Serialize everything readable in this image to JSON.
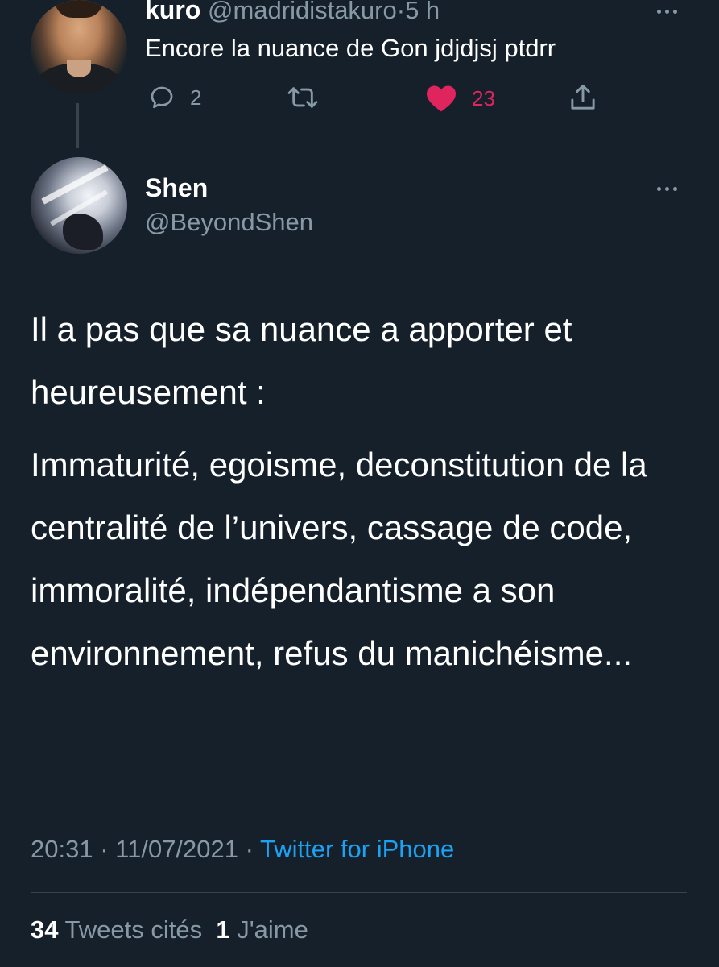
{
  "parent_tweet": {
    "author_name": "kuro",
    "handle": "@madridistakuro",
    "separator": "·",
    "time": "5 h",
    "text": "Encore la nuance de Gon jdjdjsj ptdrr",
    "reply_count": "2",
    "like_count": "23",
    "icons": [
      "reply-icon",
      "retweet-icon",
      "heart-icon",
      "share-icon",
      "more-icon"
    ],
    "liked_color": "#e0245e"
  },
  "main_tweet": {
    "author_name": "Shen",
    "handle": "@BeyondShen",
    "paragraphs": [
      "Il a pas que sa nuance a apporter et heureusement :",
      "Immaturité, egoisme, deconstitution de la centralité de l’univers, cassage de code, immoralité, indépendantisme a son environnement, refus du manichéisme..."
    ],
    "time": "20:31",
    "date": "11/07/2021",
    "separator": "·",
    "source": "Twitter for iPhone",
    "quote_count": "34",
    "quote_label": "Tweets cités",
    "like_count": "1",
    "like_label": "J'aime"
  },
  "colors": {
    "background": "#15202b",
    "muted": "#8899a6",
    "link": "#1da1f2",
    "like": "#e0245e",
    "divider": "#38444d"
  }
}
